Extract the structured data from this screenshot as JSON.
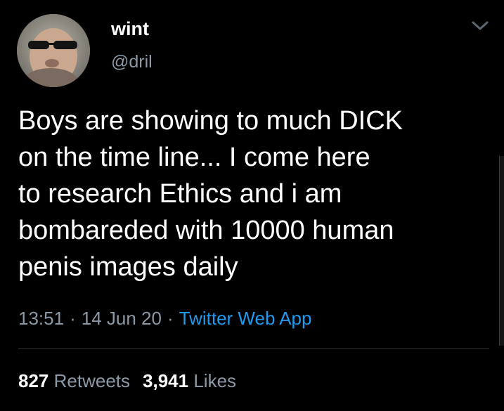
{
  "author": {
    "display_name": "wint",
    "handle": "@dril",
    "avatar_icon": "avatar-photo"
  },
  "menu": {
    "icon": "chevron-down-icon"
  },
  "tweet": {
    "text": "Boys are showing to much DICK\non the time line... I come here\nto research Ethics and i am\nbombareded with 10000 human\npenis images daily",
    "time": "13:51",
    "separator": "·",
    "date": "14 Jun 20",
    "source": "Twitter Web App"
  },
  "stats": {
    "retweets_count": "827",
    "retweets_label": "Retweets",
    "likes_count": "3,941",
    "likes_label": "Likes"
  },
  "colors": {
    "background": "#000000",
    "primary_text": "#ffffff",
    "secondary_text": "#8b98a5",
    "link": "#1d9bf0",
    "divider": "#2f3336"
  }
}
